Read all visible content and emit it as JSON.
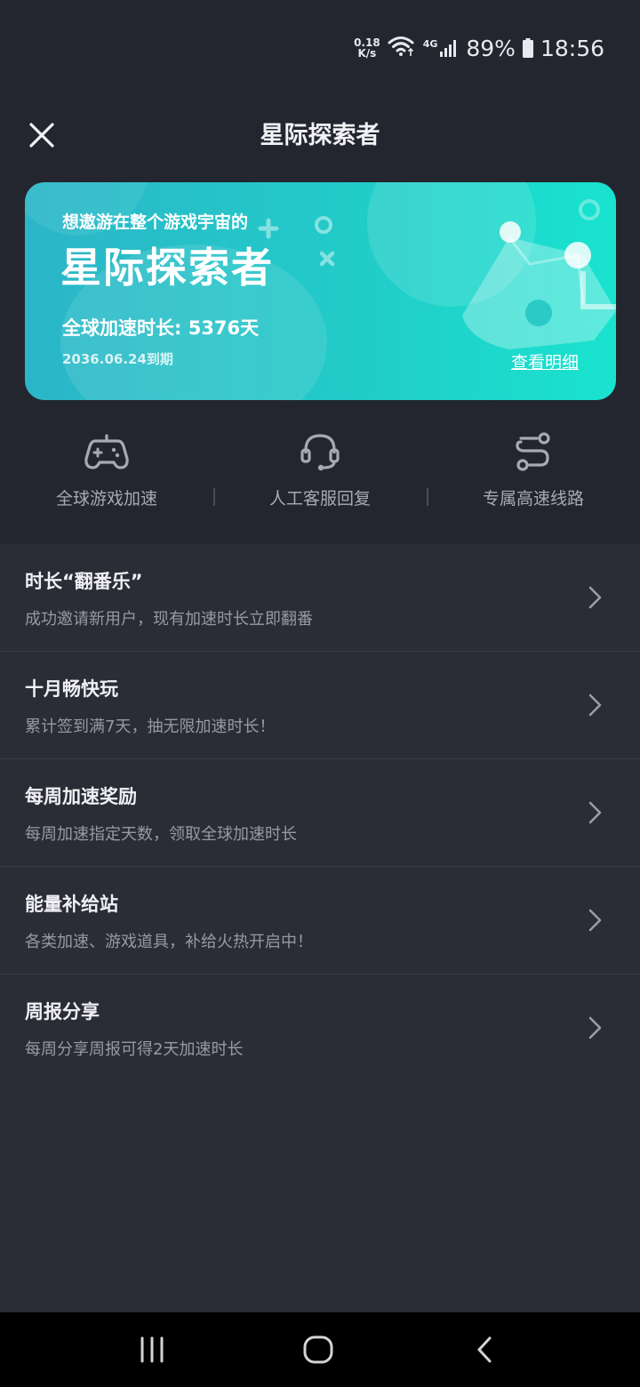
{
  "status_bar": {
    "net_speed_value": "0.18",
    "net_speed_unit": "K/s",
    "network_type": "4G",
    "battery": "89%",
    "time": "18:56"
  },
  "header": {
    "title": "星际探索者"
  },
  "banner": {
    "subtitle": "想遨游在整个游戏宇宙的",
    "title": "星际探索者",
    "duration": "全球加速时长: 5376天",
    "expire": "2036.06.24到期",
    "detail_link": "查看明细"
  },
  "features": [
    {
      "label": "全球游戏加速",
      "icon": "gamepad-icon"
    },
    {
      "label": "人工客服回复",
      "icon": "headset-icon"
    },
    {
      "label": "专属高速线路",
      "icon": "route-icon"
    }
  ],
  "list": [
    {
      "title": "时长“翻番乐”",
      "desc": "成功邀请新用户，现有加速时长立即翻番"
    },
    {
      "title": "十月畅快玩",
      "desc": "累计签到满7天，抽无限加速时长！"
    },
    {
      "title": "每周加速奖励",
      "desc": "每周加速指定天数，领取全球加速时长"
    },
    {
      "title": "能量补给站",
      "desc": "各类加速、游戏道具，补给火热开启中！"
    },
    {
      "title": "周报分享",
      "desc": "每周分享周报可得2天加速时长"
    }
  ],
  "colors": {
    "background": "#24262f",
    "list_background": "#2a2c36",
    "banner_start": "#2bb6c8",
    "banner_end": "#19e3cf"
  }
}
